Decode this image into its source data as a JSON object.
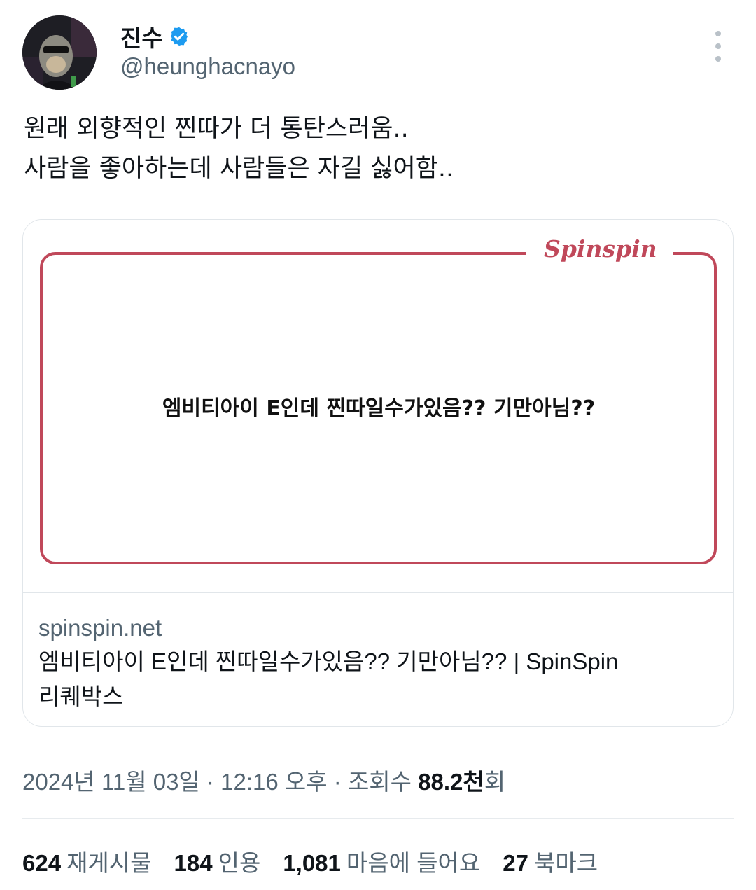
{
  "author": {
    "display_name": "진수",
    "handle": "@heunghacnayo",
    "verified": true,
    "verified_color": "#1d9bf0"
  },
  "tweet": {
    "lines": [
      "원래 외향적인 찐따가 더 통탄스러움..",
      "사람을 좋아하는데 사람들은 자길 싫어함.."
    ]
  },
  "card": {
    "logo": "Spinspin",
    "headline": "엠비티아이 E인데 찐따일수가있음?? 기만아님??",
    "domain": "spinspin.net",
    "title_line1": "엠비티아이 E인데 찐따일수가있음?? 기만아님?? | SpinSpin",
    "title_line2": "리퀘박스",
    "accent_color": "#c0485a"
  },
  "meta": {
    "date": "2024년 11월 03일",
    "sep1": " · ",
    "time": "12:16 오후",
    "sep2": " · ",
    "views_label": "조회수 ",
    "views_value": "88.2천",
    "views_suffix": "회"
  },
  "stats": [
    {
      "value": "624",
      "label": "재게시물"
    },
    {
      "value": "184",
      "label": "인용"
    },
    {
      "value": "1,081",
      "label": "마음에 들어요"
    },
    {
      "value": "27",
      "label": "북마크"
    }
  ]
}
